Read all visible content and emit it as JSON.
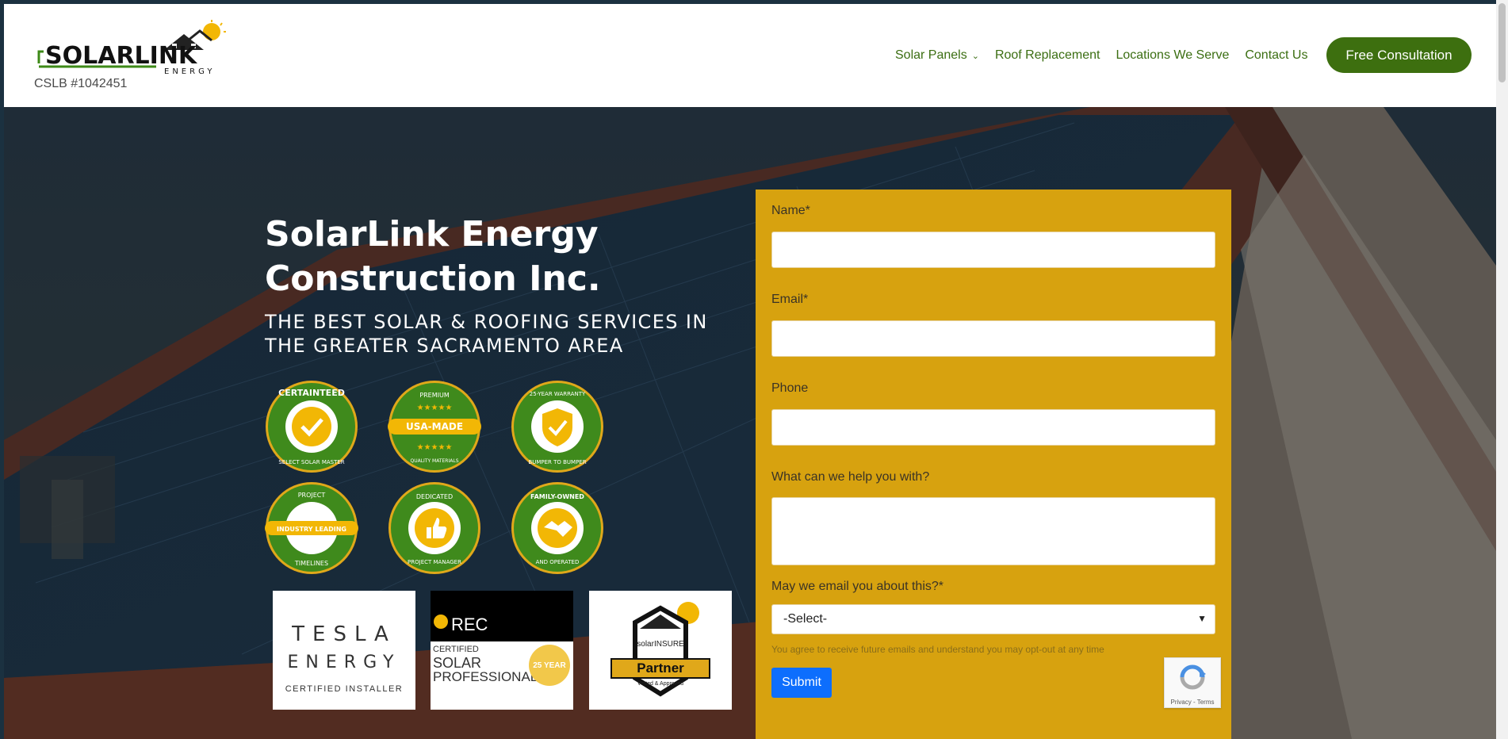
{
  "header": {
    "logo_text": "SOLARLINK ENERGY",
    "license": "CSLB #1042451",
    "nav": [
      {
        "label": "Solar Panels",
        "has_dropdown": true
      },
      {
        "label": "Roof Replacement"
      },
      {
        "label": "Locations We Serve"
      },
      {
        "label": "Contact Us"
      }
    ],
    "cta_label": "Free Consultation"
  },
  "hero": {
    "title": "SolarLink Energy Construction Inc.",
    "subtitle": "THE BEST SOLAR & ROOFING SERVICES IN THE GREATER SACRAMENTO AREA"
  },
  "badges": [
    {
      "name": "certainteed-badge",
      "top": "CERTAINTEED",
      "bottom": "SELECT SOLAR MASTER"
    },
    {
      "name": "usa-made-badge",
      "top": "PREMIUM",
      "center": "USA-MADE",
      "bottom": "QUALITY MATERIALS"
    },
    {
      "name": "warranty-badge",
      "top": "25-YEAR WARRANTY",
      "bottom": "BUMPER TO BUMPER"
    },
    {
      "name": "project-timelines-badge",
      "top": "PROJECT",
      "center": "INDUSTRY LEADING",
      "bottom": "TIMELINES"
    },
    {
      "name": "project-manager-badge",
      "top": "DEDICATED",
      "bottom": "PROJECT MANAGER"
    },
    {
      "name": "family-owned-badge",
      "top": "FAMILY-OWNED",
      "bottom": "AND OPERATED"
    }
  ],
  "partners": {
    "tesla": {
      "line1": "TESLA",
      "line2": "ENERGY",
      "line3": "CERTIFIED INSTALLER"
    },
    "rec": {
      "brand": "REC",
      "line1": "CERTIFIED",
      "line2": "SOLAR",
      "line3": "PROFESSIONAL",
      "seal": "25 YEAR"
    },
    "solarinsure": {
      "brand": "solarINSURE",
      "label": "Partner",
      "sub": "Vetted & Approved"
    }
  },
  "form": {
    "name_label": "Name*",
    "email_label": "Email*",
    "phone_label": "Phone",
    "help_label": "What can we help you with?",
    "email_opt_label": "May we email you about this?*",
    "select_value": "-Select-",
    "consent": "You agree to receive future emails and understand you may opt-out at any time",
    "submit_label": "Submit",
    "recaptcha_text": "Privacy - Terms"
  },
  "colors": {
    "brand_green": "#3d6f0f",
    "form_bg": "#d7a20f",
    "submit_blue": "#0d6efd"
  }
}
